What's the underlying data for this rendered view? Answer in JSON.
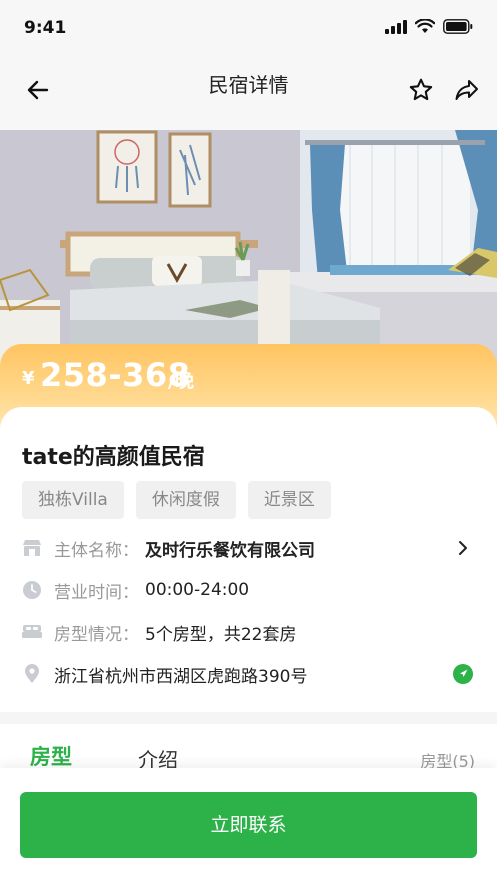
{
  "status_bar": {
    "time": "9:41"
  },
  "nav": {
    "title": "民宿详情"
  },
  "price": {
    "symbol": "¥",
    "range": "258-368",
    "unit": "/晚"
  },
  "property": {
    "name": "tate的高颜值民宿",
    "tags": [
      "独栋Villa",
      "休闲度假",
      "近景区"
    ],
    "entity_label": "主体名称：",
    "entity_value": "及时行乐餐饮有限公司",
    "hours_label": "营业时间：",
    "hours_value": "00:00-24:00",
    "rooms_label": "房型情况：",
    "rooms_value": "5个房型，共22套房",
    "address": "浙江省杭州市西湖区虎跑路390号"
  },
  "tabs": {
    "room": "房型",
    "intro": "介绍",
    "count": "房型(5)"
  },
  "actions": {
    "contact": "立即联系"
  },
  "colors": {
    "accent_green": "#2db24a",
    "price_orange": "#ffc461"
  }
}
